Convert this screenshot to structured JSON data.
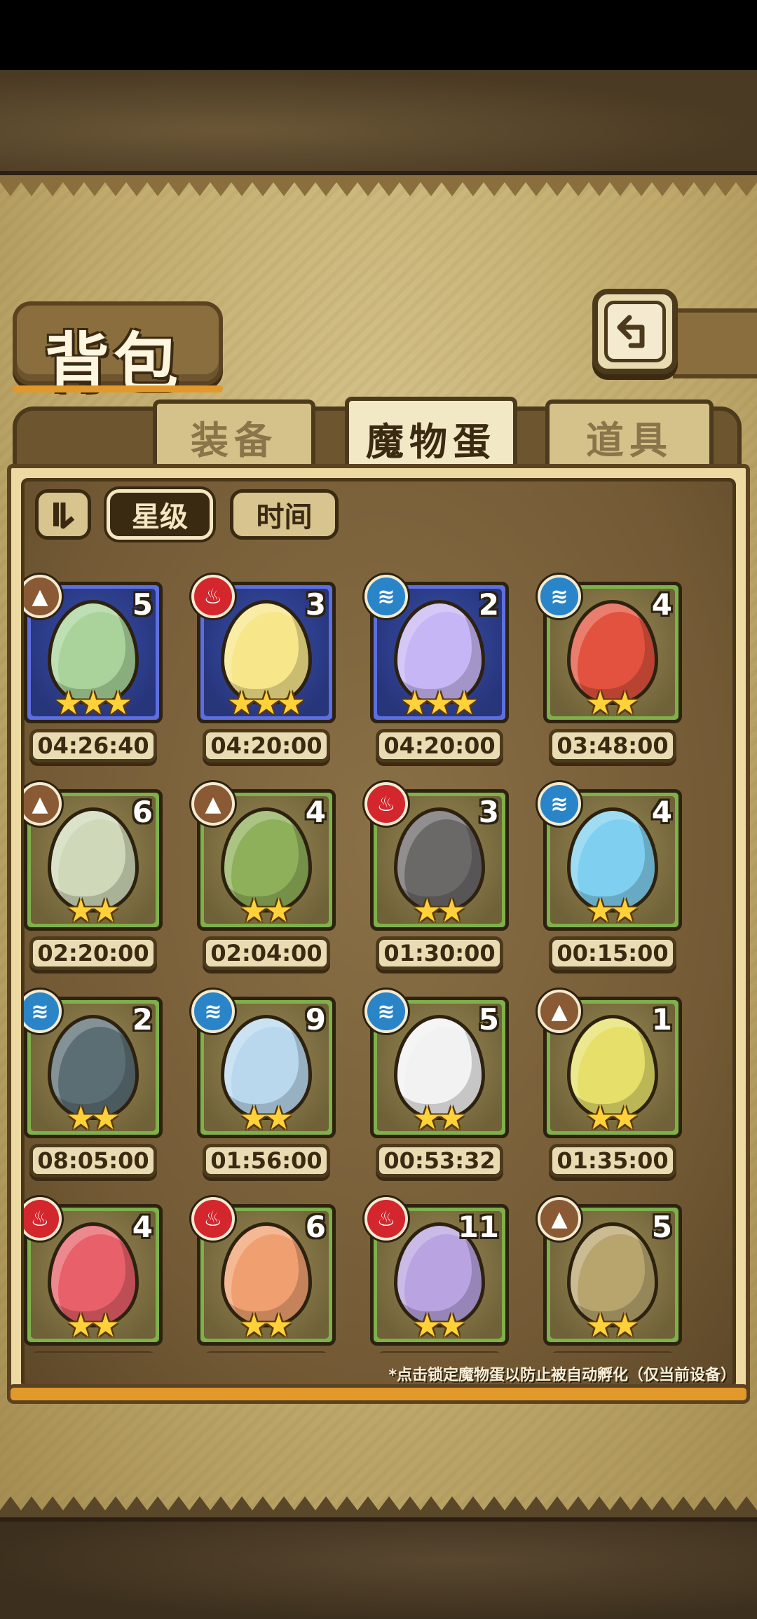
{
  "header": {
    "title": "背包",
    "back_icon": "back-arrow-icon"
  },
  "tabs": [
    {
      "label": "装备",
      "active": false
    },
    {
      "label": "魔物蛋",
      "active": true
    },
    {
      "label": "道具",
      "active": false
    }
  ],
  "sort": {
    "toggle_icon": "pause-sort-icon",
    "star_label": "星级",
    "time_label": "时间",
    "active": "星级"
  },
  "eggs": [
    {
      "element": "earth",
      "count": "5",
      "stars": 3,
      "frame": "blue",
      "timer": "04:26:40",
      "color": "#a9d39a"
    },
    {
      "element": "fire",
      "count": "3",
      "stars": 3,
      "frame": "blue",
      "timer": "04:20:00",
      "color": "#f7e68a"
    },
    {
      "element": "water",
      "count": "2",
      "stars": 3,
      "frame": "blue",
      "timer": "04:20:00",
      "color": "#c7b6f5"
    },
    {
      "element": "water",
      "count": "4",
      "stars": 2,
      "frame": "green",
      "timer": "03:48:00",
      "color": "#e2523e"
    },
    {
      "element": "earth",
      "count": "6",
      "stars": 2,
      "frame": "green",
      "timer": "02:20:00",
      "color": "#cfd8b8"
    },
    {
      "element": "earth",
      "count": "4",
      "stars": 2,
      "frame": "green",
      "timer": "02:04:00",
      "color": "#8fb05a"
    },
    {
      "element": "fire",
      "count": "3",
      "stars": 2,
      "frame": "green",
      "timer": "01:30:00",
      "color": "#6b6868"
    },
    {
      "element": "water",
      "count": "4",
      "stars": 2,
      "frame": "green",
      "timer": "00:15:00",
      "color": "#7fd0f0"
    },
    {
      "element": "water",
      "count": "2",
      "stars": 2,
      "frame": "green",
      "timer": "08:05:00",
      "color": "#5b6e74"
    },
    {
      "element": "water",
      "count": "9",
      "stars": 2,
      "frame": "green",
      "timer": "01:56:00",
      "color": "#b9d8ee"
    },
    {
      "element": "water",
      "count": "5",
      "stars": 2,
      "frame": "green",
      "timer": "00:53:32",
      "color": "#f2f2f2"
    },
    {
      "element": "earth",
      "count": "1",
      "stars": 2,
      "frame": "green",
      "timer": "01:35:00",
      "color": "#e6e06a"
    },
    {
      "element": "fire",
      "count": "4",
      "stars": 2,
      "frame": "green",
      "timer": "",
      "color": "#e8606a"
    },
    {
      "element": "fire",
      "count": "6",
      "stars": 2,
      "frame": "green",
      "timer": "",
      "color": "#f0a070"
    },
    {
      "element": "fire",
      "count": "11",
      "stars": 2,
      "frame": "green",
      "timer": "",
      "color": "#b9a3e0"
    },
    {
      "element": "earth",
      "count": "5",
      "stars": 2,
      "frame": "green",
      "timer": "",
      "color": "#b8a56e"
    }
  ],
  "footer_note": "*点击锁定魔物蛋以防止被自动孵化（仅当前设备）"
}
